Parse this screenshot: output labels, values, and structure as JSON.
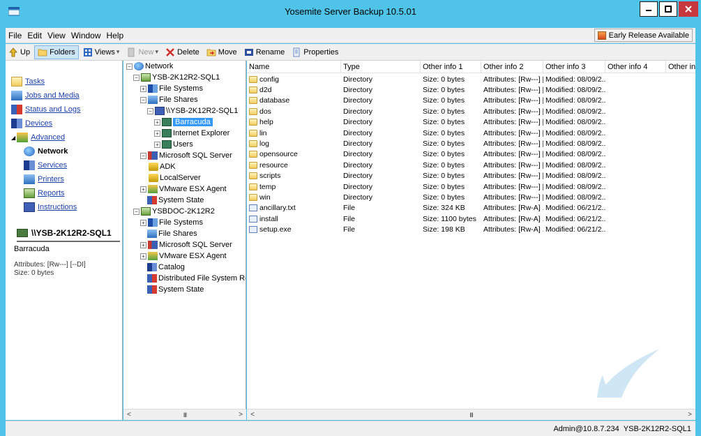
{
  "window": {
    "title": "Yosemite Server Backup 10.5.01"
  },
  "menu": [
    "File",
    "Edit",
    "View",
    "Window",
    "Help"
  ],
  "early_release": "Early Release Available",
  "toolbar": {
    "up": "Up",
    "folders": "Folders",
    "views": "Views",
    "new": "New",
    "delete": "Delete",
    "move": "Move",
    "rename": "Rename",
    "properties": "Properties"
  },
  "nav": {
    "tasks": "Tasks",
    "jobs": "Jobs and Media",
    "status": "Status and Logs",
    "devices": "Devices",
    "advanced": "Advanced",
    "network": "Network",
    "services": "Services",
    "printers": "Printers",
    "reports": "Reports",
    "instructions": "Instructions"
  },
  "selection": {
    "title": "\\\\YSB-2K12R2-SQL1",
    "name": "Barracuda",
    "attributes": "Attributes: [Rw---] [--DI]",
    "size": "Size: 0 bytes"
  },
  "tree": [
    "Network",
    "YSB-2K12R2-SQL1",
    "File Systems",
    "File Shares",
    "\\\\YSB-2K12R2-SQL1",
    "Barracuda",
    "Internet Explorer",
    "Users",
    "Microsoft SQL Server",
    "ADK",
    "LocalServer",
    "VMware ESX Agent",
    "System State",
    "YSBDOC-2K12R2",
    "File Systems",
    "File Shares",
    "Microsoft SQL Server",
    "VMware ESX Agent",
    "Catalog",
    "Distributed File System Replica",
    "System State"
  ],
  "columns": [
    "Name",
    "Type",
    "Other info 1",
    "Other info 2",
    "Other info 3",
    "Other info 4",
    "Other info"
  ],
  "rows": [
    [
      "config",
      "Directory",
      "Size: 0 bytes",
      "Attributes: [Rw---] [...",
      "Modified: 08/09/2..."
    ],
    [
      "d2d",
      "Directory",
      "Size: 0 bytes",
      "Attributes: [Rw---] [...",
      "Modified: 08/09/2..."
    ],
    [
      "database",
      "Directory",
      "Size: 0 bytes",
      "Attributes: [Rw---] [...",
      "Modified: 08/09/2..."
    ],
    [
      "dos",
      "Directory",
      "Size: 0 bytes",
      "Attributes: [Rw---] [...",
      "Modified: 08/09/2..."
    ],
    [
      "help",
      "Directory",
      "Size: 0 bytes",
      "Attributes: [Rw---] [...",
      "Modified: 08/09/2..."
    ],
    [
      "lin",
      "Directory",
      "Size: 0 bytes",
      "Attributes: [Rw---] [...",
      "Modified: 08/09/2..."
    ],
    [
      "log",
      "Directory",
      "Size: 0 bytes",
      "Attributes: [Rw---] [...",
      "Modified: 08/09/2..."
    ],
    [
      "opensource",
      "Directory",
      "Size: 0 bytes",
      "Attributes: [Rw---] [...",
      "Modified: 08/09/2..."
    ],
    [
      "resource",
      "Directory",
      "Size: 0 bytes",
      "Attributes: [Rw---] [...",
      "Modified: 08/09/2..."
    ],
    [
      "scripts",
      "Directory",
      "Size: 0 bytes",
      "Attributes: [Rw---] [...",
      "Modified: 08/09/2..."
    ],
    [
      "temp",
      "Directory",
      "Size: 0 bytes",
      "Attributes: [Rw---] [...",
      "Modified: 08/09/2..."
    ],
    [
      "win",
      "Directory",
      "Size: 0 bytes",
      "Attributes: [Rw---] [...",
      "Modified: 08/09/2..."
    ],
    [
      "ancillary.txt",
      "File",
      "Size: 324 KB",
      "Attributes: [Rw-A] ...",
      "Modified: 06/21/2..."
    ],
    [
      "install",
      "File",
      "Size: 1100 bytes",
      "Attributes: [Rw-A] ...",
      "Modified: 06/21/2..."
    ],
    [
      "setup.exe",
      "File",
      "Size: 198 KB",
      "Attributes: [Rw-A] ...",
      "Modified: 06/21/2..."
    ]
  ],
  "scroll": {
    "grip": "III"
  },
  "status": {
    "user": "Admin@10.8.7.234",
    "server": "YSB-2K12R2-SQL1"
  }
}
